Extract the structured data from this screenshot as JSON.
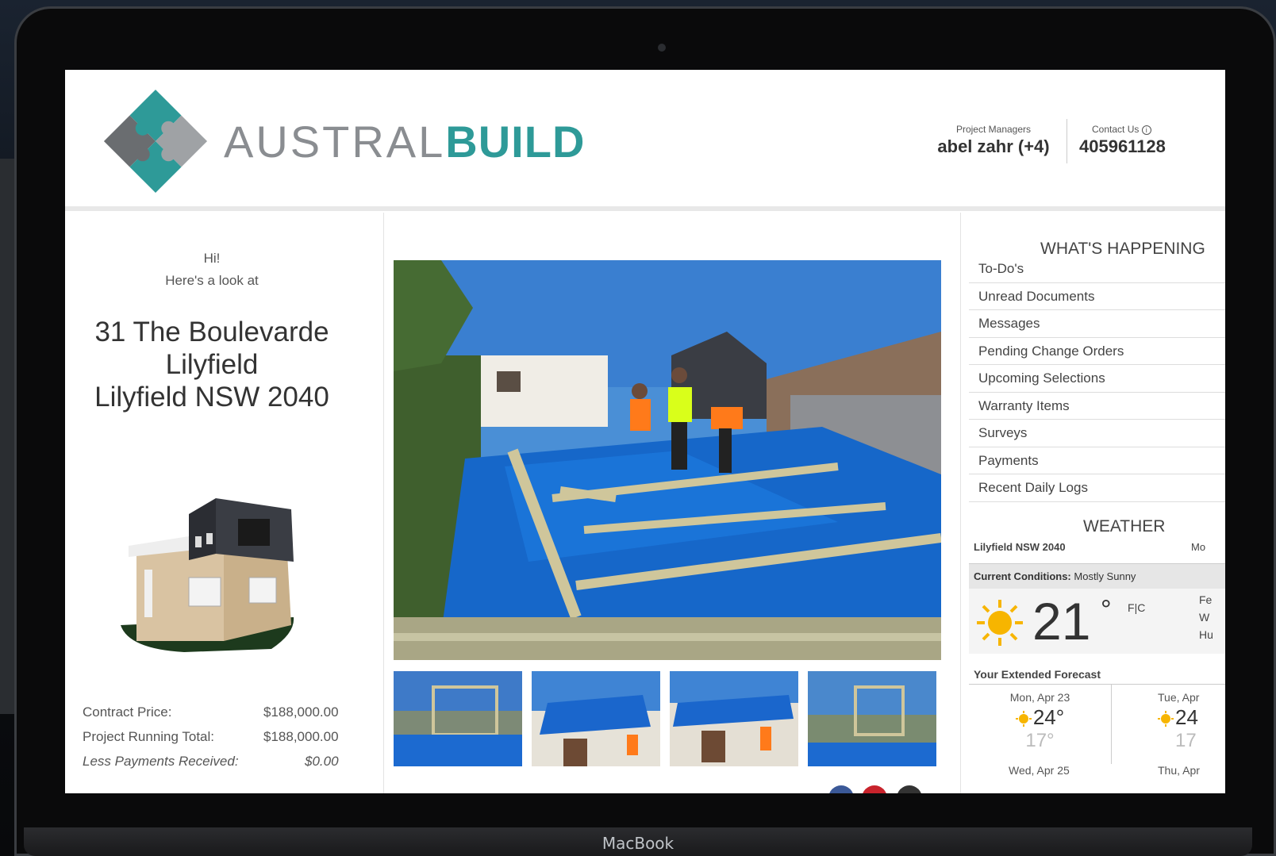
{
  "device": {
    "label": "MacBook"
  },
  "header": {
    "logo": {
      "light": "AUSTRAL",
      "bold": "BUILD"
    },
    "pm_label": "Project Managers",
    "pm_name": "abel zahr (+4)",
    "contact_label": "Contact Us",
    "contact_number": "405961128"
  },
  "left": {
    "greeting": "Hi!",
    "subgreeting": "Here's a look at",
    "address_line1": "31 The Boulevarde",
    "address_line2": "Lilyfield",
    "address_line3": "Lilyfield NSW 2040",
    "financials": [
      {
        "label": "Contract Price:",
        "value": "$188,000.00"
      },
      {
        "label": "Project Running Total:",
        "value": "$188,000.00"
      },
      {
        "label": "Less Payments Received:",
        "value": "$0.00"
      }
    ]
  },
  "whats_happening": {
    "title": "WHAT'S HAPPENING",
    "items": [
      "To-Do's",
      "Unread Documents",
      "Messages",
      "Pending Change Orders",
      "Upcoming Selections",
      "Warranty Items",
      "Surveys",
      "Payments",
      "Recent Daily Logs"
    ]
  },
  "weather": {
    "title": "WEATHER",
    "location": "Lilyfield NSW 2040",
    "side_text": "Mo",
    "current_label": "Current Conditions:",
    "current_value": "Mostly Sunny",
    "temp": "21",
    "deg": "°",
    "unit_f": "F",
    "unit_c": "C",
    "side_lines": [
      "Fe",
      "W",
      "Hu"
    ],
    "extended_title": "Your Extended Forecast",
    "forecast": [
      {
        "day": "Mon, Apr 23",
        "hi": "24°",
        "lo": "17°"
      },
      {
        "day": "Tue, Apr",
        "hi": "24",
        "lo": "17"
      }
    ],
    "forecast_next": [
      "Wed, Apr 25",
      "Thu, Apr"
    ]
  },
  "colors": {
    "brand_teal": "#2e9a98",
    "brand_gray": "#8a8d91",
    "sun": "#f7b500"
  }
}
